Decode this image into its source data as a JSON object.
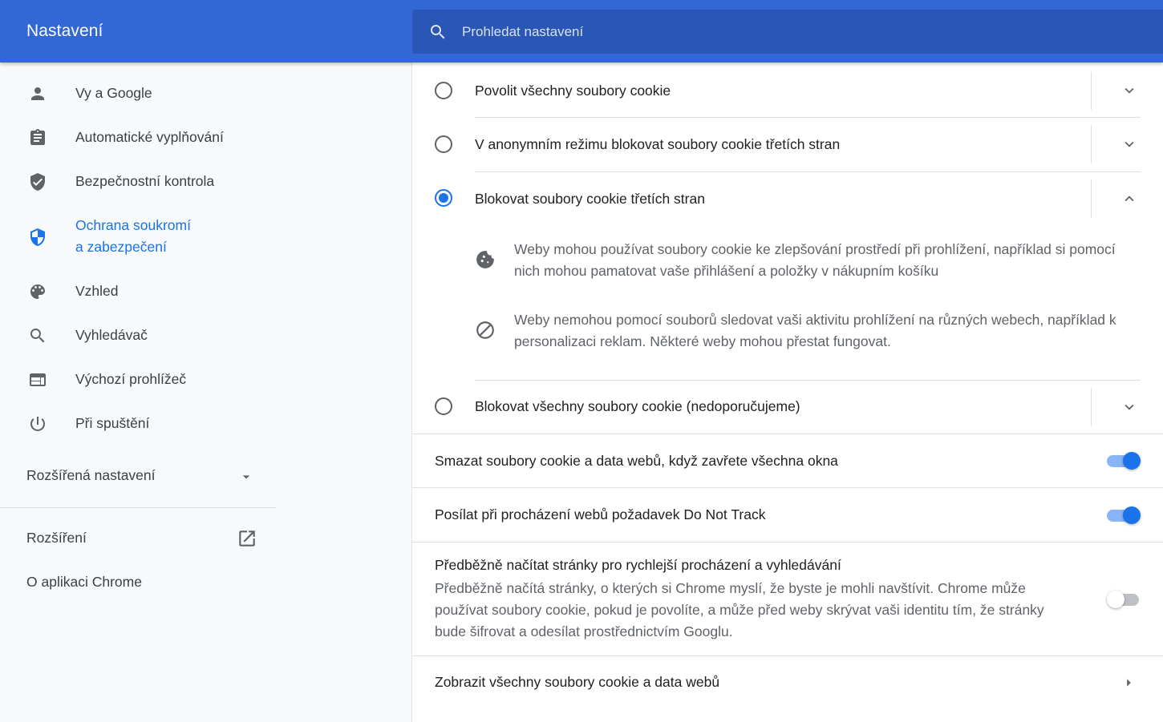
{
  "header": {
    "title": "Nastavení",
    "search_placeholder": "Prohledat nastavení"
  },
  "sidebar": {
    "items": [
      {
        "label": "Vy a Google",
        "icon": "person-icon"
      },
      {
        "label": "Automatické vyplňování",
        "icon": "clipboard-icon"
      },
      {
        "label": "Bezpečnostní kontrola",
        "icon": "shield-check-icon"
      },
      {
        "label_line1": "Ochrana soukromí",
        "label_line2": "a zabezpečení",
        "icon": "shield-icon",
        "active": true
      },
      {
        "label": "Vzhled",
        "icon": "palette-icon"
      },
      {
        "label": "Vyhledávač",
        "icon": "search-icon"
      },
      {
        "label": "Výchozí prohlížeč",
        "icon": "browser-icon"
      },
      {
        "label": "Při spuštění",
        "icon": "power-icon"
      }
    ],
    "advanced": "Rozšířená nastavení",
    "extensions": "Rozšíření",
    "about": "O aplikaci Chrome"
  },
  "cookies": {
    "options": [
      {
        "label": "Povolit všechny soubory cookie",
        "checked": false
      },
      {
        "label": "V anonymním režimu blokovat soubory cookie třetích stran",
        "checked": false
      },
      {
        "label": "Blokovat soubory cookie třetích stran",
        "checked": true,
        "expanded": true
      },
      {
        "label": "Blokovat všechny soubory cookie (nedoporučujeme)",
        "checked": false
      }
    ],
    "details": [
      {
        "icon": "cookie-icon",
        "text": "Weby mohou používat soubory cookie ke zlepšování prostředí při prohlížení, například si pomocí nich mohou pamatovat vaše přihlášení a položky v nákupním košíku"
      },
      {
        "icon": "block-icon",
        "text": "Weby nemohou pomocí souborů sledovat vaši aktivitu prohlížení na různých webech, například k personalizaci reklam. Některé weby mohou přestat fungovat."
      }
    ]
  },
  "settings": {
    "clear_on_exit": {
      "label": "Smazat soubory cookie a data webů, když zavřete všechna okna",
      "on": true
    },
    "do_not_track": {
      "label": "Posílat při procházení webů požadavek Do Not Track",
      "on": true
    },
    "preload": {
      "title": "Předběžně načítat stránky pro rychlejší procházení a vyhledávání",
      "description": "Předběžně načítá stránky, o kterých si Chrome myslí, že byste je mohli navštívit. Chrome může používat soubory cookie, pokud je povolíte, a může před weby skrývat vaši identitu tím, že stránky bude šifrovat a odesílat prostřednictvím Googlu.",
      "on": false
    },
    "see_all": {
      "label": "Zobrazit všechny soubory cookie a data webů"
    }
  },
  "colors": {
    "header": "#3367d6",
    "accent": "#1a73e8"
  }
}
